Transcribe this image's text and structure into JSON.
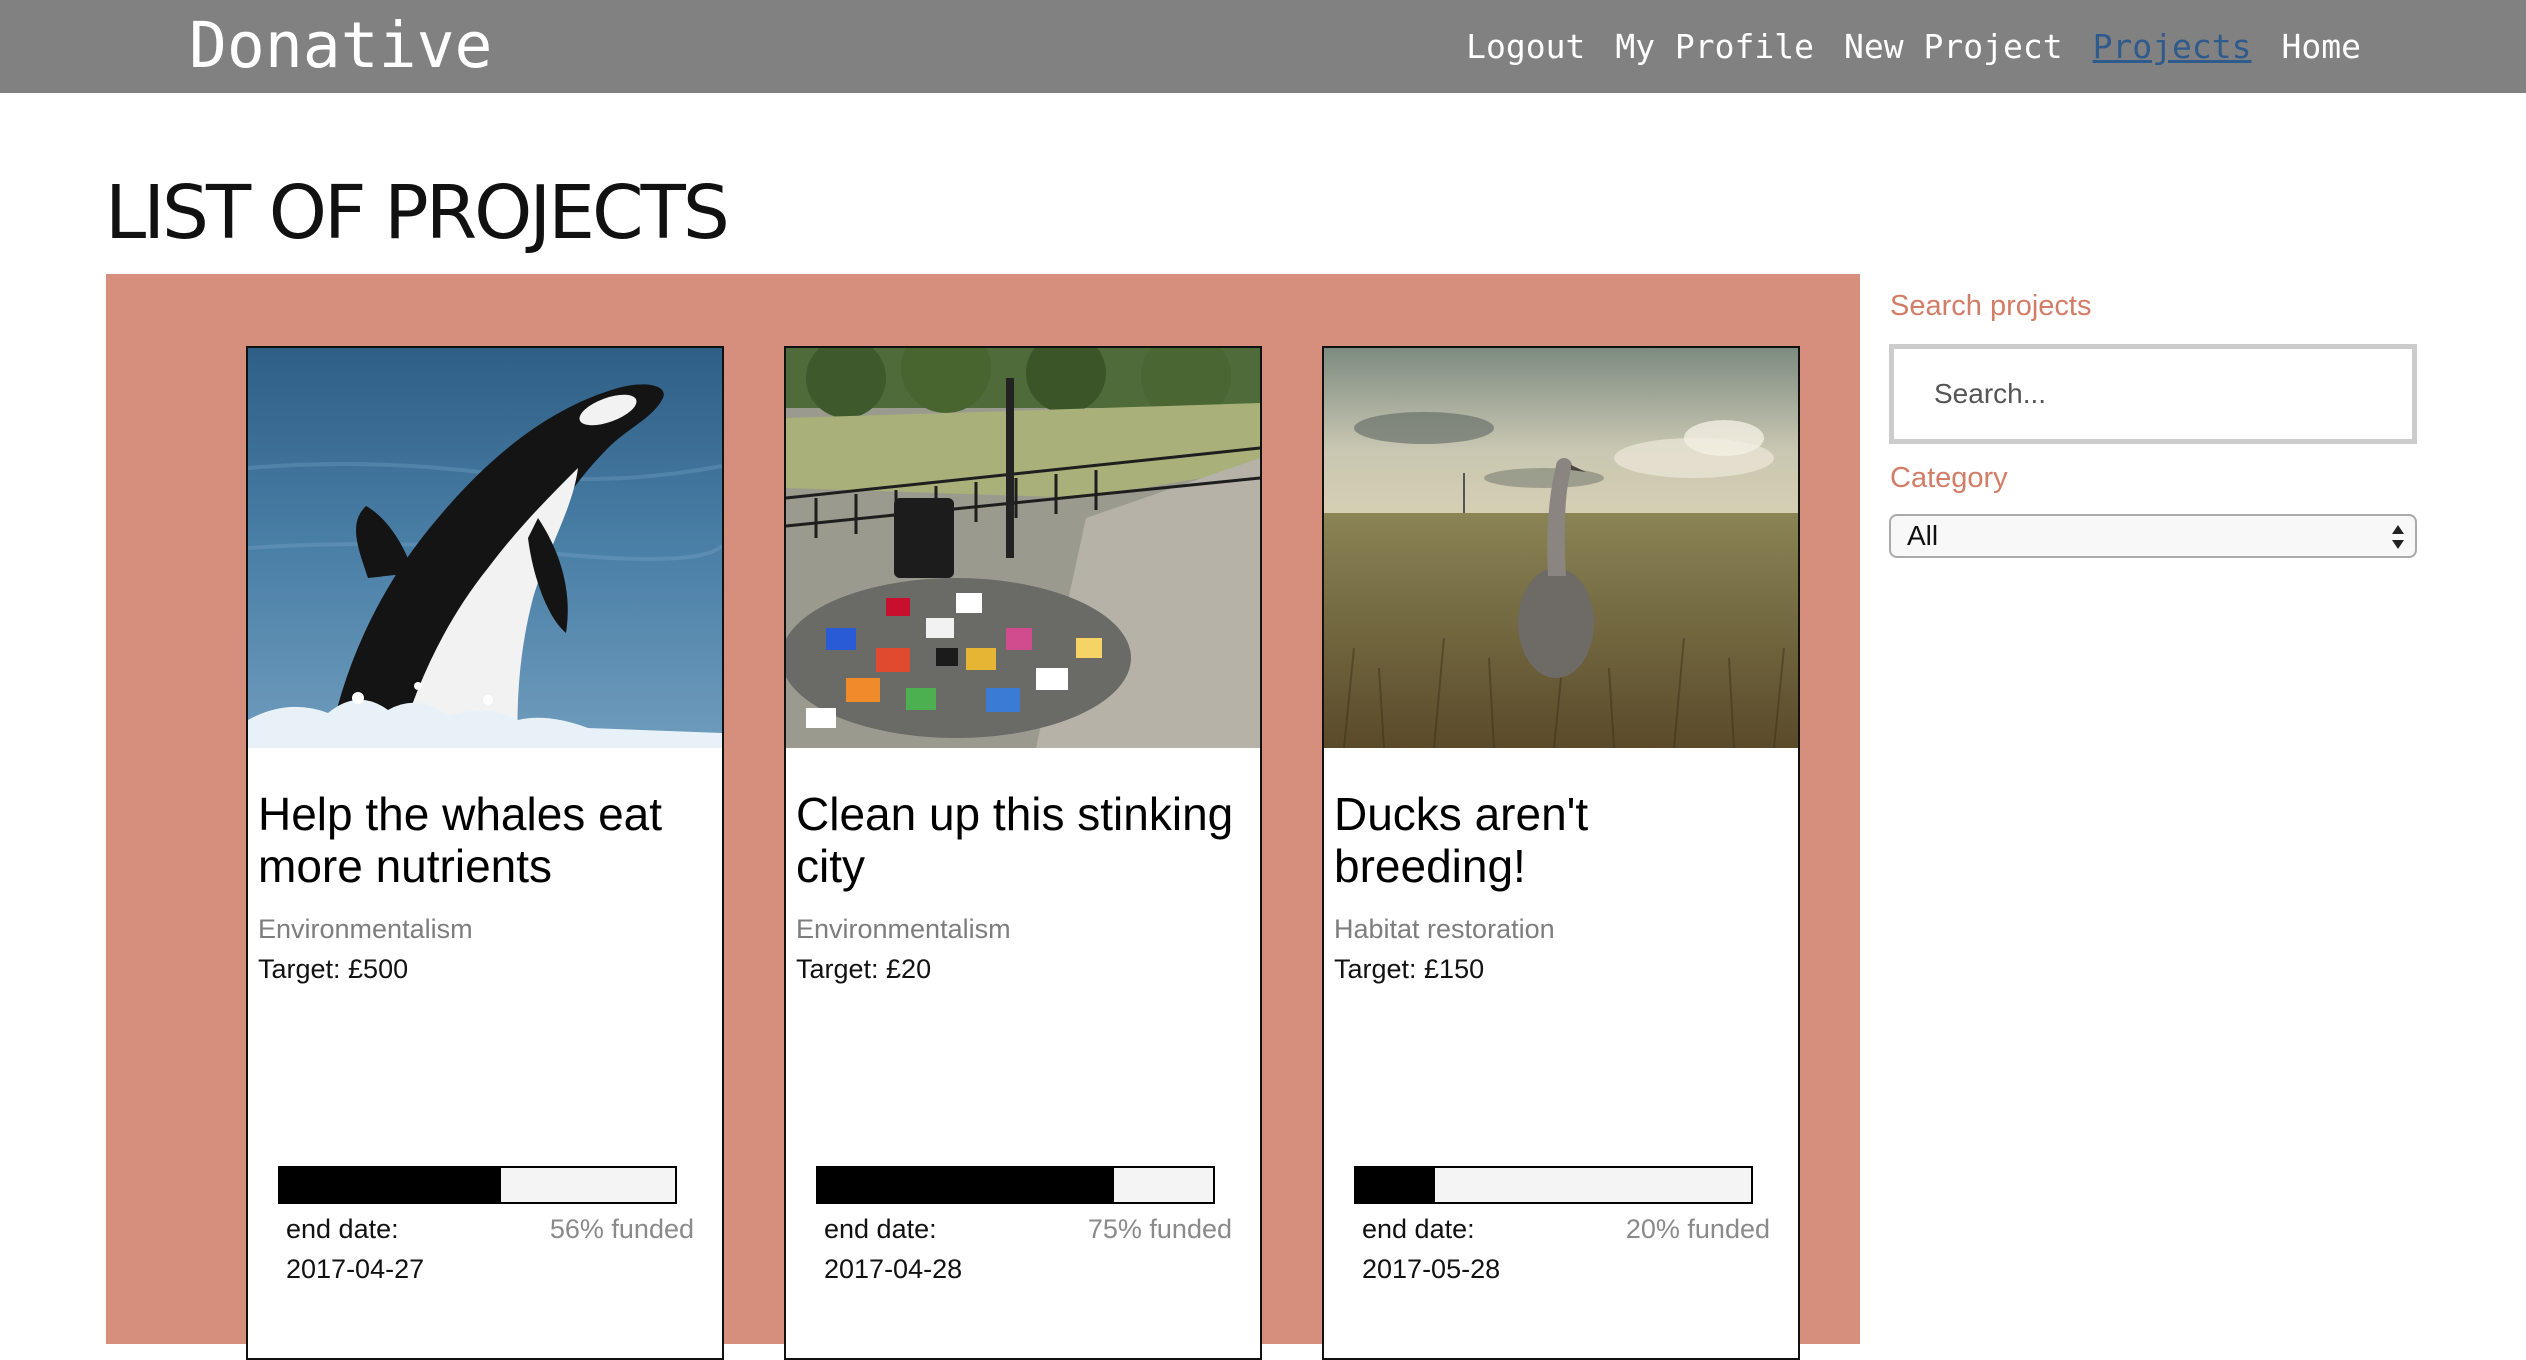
{
  "navbar": {
    "brand": "Donative",
    "links": [
      {
        "label": "Logout",
        "active": false
      },
      {
        "label": "My Profile",
        "active": false
      },
      {
        "label": "New Project",
        "active": false
      },
      {
        "label": "Projects",
        "active": true
      },
      {
        "label": "Home",
        "active": false
      }
    ]
  },
  "page": {
    "title": "LIST OF PROJECTS"
  },
  "projects": [
    {
      "image": "orca-breaching-photo",
      "title": "Help the whales eat more nutrients",
      "category": "Environmentalism",
      "target": "Target: £500",
      "funded_percent": 56,
      "funded_text": "56% funded",
      "end_date_label": "end date:",
      "end_date": "2017-04-27"
    },
    {
      "image": "litter-pile-photo",
      "title": "Clean up this stinking city",
      "category": "Environmentalism",
      "target": "Target: £20",
      "funded_percent": 75,
      "funded_text": "75% funded",
      "end_date_label": "end date:",
      "end_date": "2017-04-28"
    },
    {
      "image": "bird-in-field-photo",
      "title": "Ducks aren't breeding!",
      "category": "Habitat restoration",
      "target": "Target: £150",
      "funded_percent": 20,
      "funded_text": "20% funded",
      "end_date_label": "end date:",
      "end_date": "2017-05-28"
    }
  ],
  "sidebar": {
    "search_label": "Search projects",
    "search_placeholder": "Search...",
    "search_value": "",
    "category_label": "Category",
    "category_selected": "All",
    "arrows_icon": "select-arrows-icon"
  },
  "colors": {
    "navbar_bg": "#818181",
    "panel_bg": "#d58f7c",
    "accent_label": "#d27d67",
    "active_link": "#2e5a8c"
  }
}
